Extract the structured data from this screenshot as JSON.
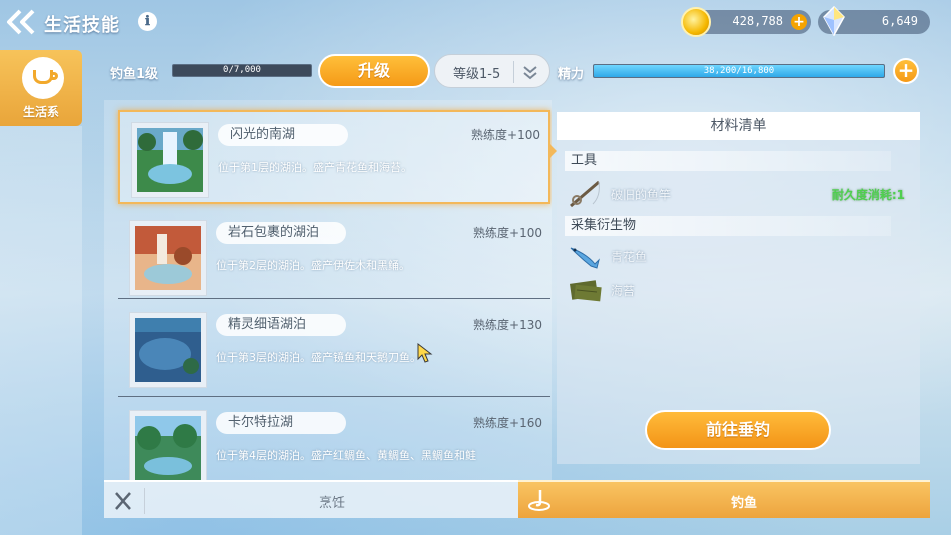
{
  "header": {
    "title": "生活技能",
    "info_icon": "ℹ",
    "gold": "428,788",
    "crystal": "6,649"
  },
  "side_tab": {
    "label": "生活系"
  },
  "skill": {
    "level_label": "钓鱼1级",
    "exp_text": "0/7,000",
    "upgrade_label": "升级",
    "level_range": "等级1-5",
    "energy_label": "精力",
    "energy_text": "38,200/16,800",
    "energy_fraction": 1.0
  },
  "lakes": [
    {
      "name": "闪光的南湖",
      "proficiency": "熟练度+100",
      "desc": "位于第1层的湖泊。盛产青花鱼和海苔。",
      "selected": true
    },
    {
      "name": "岩石包裹的湖泊",
      "proficiency": "熟练度+100",
      "desc": "位于第2层的湖泊。盛产伊佐木和黑鲬。",
      "selected": false
    },
    {
      "name": "精灵细语湖泊",
      "proficiency": "熟练度+130",
      "desc": "位于第3层的湖泊。盛产镜鱼和天鹅刀鱼。",
      "selected": false
    },
    {
      "name": "卡尔特拉湖",
      "proficiency": "熟练度+160",
      "desc": "位于第4层的湖泊。盛产红鲷鱼、黄鲷鱼、黑鲷鱼和鲑",
      "selected": false
    }
  ],
  "materials": {
    "title": "材料清单",
    "tools_header": "工具",
    "tool_name": "破旧的鱼竿",
    "tool_durability": "耐久度消耗:1",
    "creatures_header": "采集衍生物",
    "creatures": [
      "青花鱼",
      "海苔"
    ],
    "go_button": "前往垂钓"
  },
  "tabs": {
    "cooking": "烹饪",
    "fishing": "钓鱼"
  },
  "colors": {
    "accent": "#f59a17",
    "energy": "#2fa8e8",
    "durability": "#4fcf4f"
  }
}
